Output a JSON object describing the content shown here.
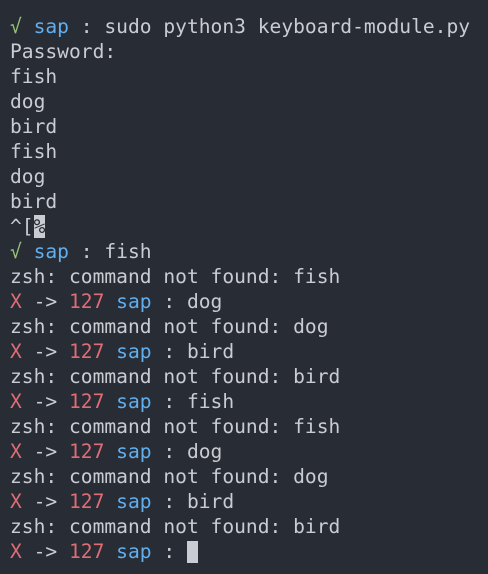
{
  "colors": {
    "background": "#282c34",
    "text": "#c9ccd3",
    "check": "#98c379",
    "user": "#61afef",
    "error": "#e06c75"
  },
  "prompt": {
    "ok_symbol": "√",
    "fail_symbol": "X",
    "arrow": "->",
    "exit_code": "127",
    "user": "sap",
    "separator": ":"
  },
  "session": {
    "first_command": "sudo python3 keyboard-module.py",
    "password_prompt": "Password:",
    "script_output": [
      "fish",
      "dog",
      "bird",
      "fish",
      "dog",
      "bird"
    ],
    "escape_seq": "^[",
    "escape_cursor": "%",
    "second_command": "fish",
    "errors": [
      {
        "message": "zsh: command not found: fish",
        "next_command": "dog"
      },
      {
        "message": "zsh: command not found: dog",
        "next_command": "bird"
      },
      {
        "message": "zsh: command not found: bird",
        "next_command": "fish"
      },
      {
        "message": "zsh: command not found: fish",
        "next_command": "dog"
      },
      {
        "message": "zsh: command not found: dog",
        "next_command": "bird"
      },
      {
        "message": "zsh: command not found: bird",
        "next_command": ""
      }
    ]
  }
}
